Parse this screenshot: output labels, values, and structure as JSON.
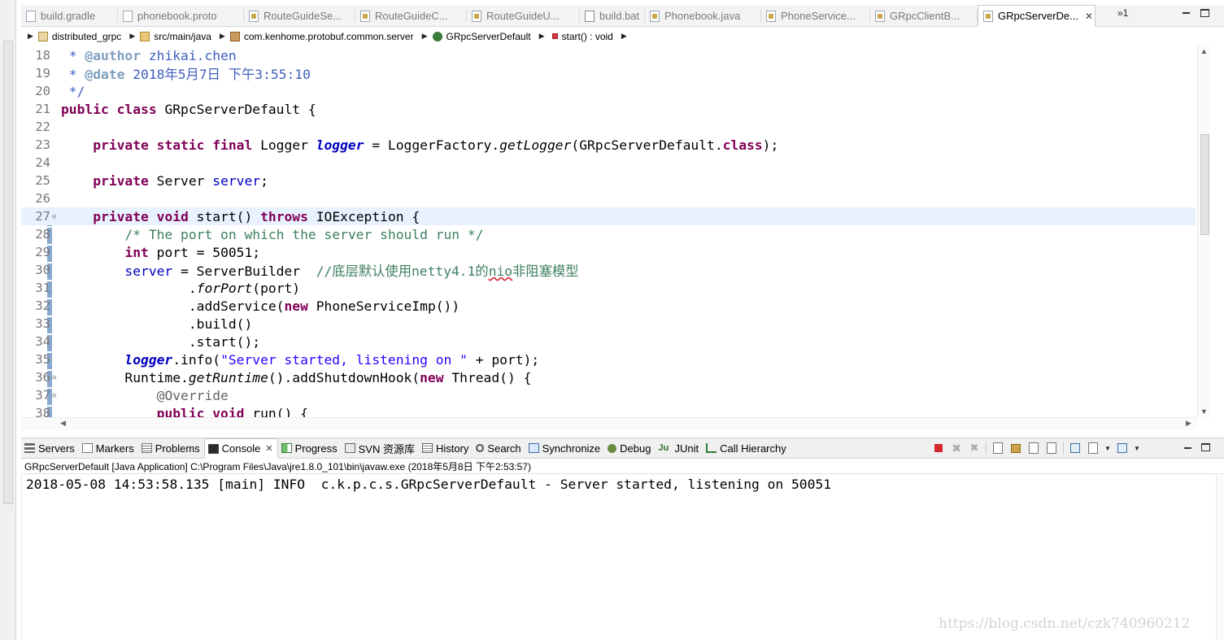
{
  "editor_tabs": [
    {
      "label": "build.gradle",
      "icon": "gradle-file-icon",
      "active": false
    },
    {
      "label": "phonebook.proto",
      "icon": "proto-file-icon",
      "active": false
    },
    {
      "label": "RouteGuideSe...",
      "icon": "java-file-icon",
      "active": false
    },
    {
      "label": "RouteGuideC...",
      "icon": "java-file-icon",
      "active": false
    },
    {
      "label": "RouteGuideU...",
      "icon": "java-file-icon",
      "active": false
    },
    {
      "label": "build.bat",
      "icon": "bat-file-icon",
      "active": false
    },
    {
      "label": "Phonebook.java",
      "icon": "java-file-icon",
      "active": false
    },
    {
      "label": "PhoneService...",
      "icon": "java-file-icon",
      "active": false
    },
    {
      "label": "GRpcClientB...",
      "icon": "java-file-icon",
      "active": false
    },
    {
      "label": "GRpcServerDe...",
      "icon": "java-file-icon",
      "active": true
    }
  ],
  "tabs_overflow": "»1",
  "breadcrumb": {
    "project": "distributed_grpc",
    "source_folder": "src/main/java",
    "package": "com.kenhome.protobuf.common.server",
    "class": "GRpcServerDefault",
    "method": "start() : void"
  },
  "code_lines": [
    {
      "n": "18",
      "fold": ""
    },
    {
      "n": "19",
      "fold": ""
    },
    {
      "n": "20",
      "fold": ""
    },
    {
      "n": "21",
      "fold": ""
    },
    {
      "n": "22",
      "fold": ""
    },
    {
      "n": "23",
      "fold": ""
    },
    {
      "n": "24",
      "fold": ""
    },
    {
      "n": "25",
      "fold": ""
    },
    {
      "n": "26",
      "fold": ""
    },
    {
      "n": "27",
      "fold": "⊖"
    },
    {
      "n": "28",
      "fold": ""
    },
    {
      "n": "29",
      "fold": ""
    },
    {
      "n": "30",
      "fold": ""
    },
    {
      "n": "31",
      "fold": ""
    },
    {
      "n": "32",
      "fold": ""
    },
    {
      "n": "33",
      "fold": ""
    },
    {
      "n": "34",
      "fold": ""
    },
    {
      "n": "35",
      "fold": ""
    },
    {
      "n": "36",
      "fold": "⊖"
    },
    {
      "n": "37",
      "fold": "⊖"
    },
    {
      "n": "38",
      "fold": ""
    }
  ],
  "code": {
    "l18": {
      "star": " * ",
      "tag": "@author",
      "text": " zhikai.chen"
    },
    "l19": {
      "star": " * ",
      "tag": "@date",
      "text": " 2018年5月7日 下午3:55:10"
    },
    "l20": {
      "text": " */"
    },
    "l21": {
      "kw": "public class",
      "text": " GRpcServerDefault {"
    },
    "l23": {
      "indent": "    ",
      "kw": "private static final",
      "t1": " Logger ",
      "field": "logger",
      "t2": " = LoggerFactory.",
      "method": "getLogger",
      "t3": "(GRpcServerDefault.",
      "kw2": "class",
      "t4": ");"
    },
    "l25": {
      "indent": "    ",
      "kw": "private",
      "t1": " Server ",
      "field": "server",
      "t2": ";"
    },
    "l27": {
      "indent": "    ",
      "kw": "private void",
      "t1": " start() ",
      "kw2": "throws",
      "t2": " IOException {"
    },
    "l28": {
      "indent": "        ",
      "comment": "/* The port on which the server should run */"
    },
    "l29": {
      "indent": "        ",
      "kw": "int",
      "t1": " port = 50051;"
    },
    "l30": {
      "indent": "        ",
      "field": "server",
      "t1": " = ServerBuilder  ",
      "comment_a": "//底层默认使用netty4.1的",
      "comment_b": "nio",
      "comment_c": "非阻塞模型"
    },
    "l31": {
      "indent": "                ",
      "t1": ".",
      "method": "forPort",
      "t2": "(port)"
    },
    "l32": {
      "indent": "                ",
      "t1": ".addService(",
      "kw": "new",
      "t2": " PhoneServiceImp())"
    },
    "l33": {
      "indent": "                ",
      "t1": ".build()"
    },
    "l34": {
      "indent": "                ",
      "t1": ".start();"
    },
    "l35": {
      "indent": "        ",
      "field": "logger",
      "t1": ".info(",
      "str": "\"Server started, listening on \"",
      "t2": " + port);"
    },
    "l36": {
      "indent": "        ",
      "t1": "Runtime.",
      "method": "getRuntime",
      "t2": "().addShutdownHook(",
      "kw": "new",
      "t3": " Thread() {"
    },
    "l37": {
      "indent": "            ",
      "ann": "@Override"
    },
    "l38": {
      "indent": "            ",
      "kw": "public void",
      "t1": " run() {"
    }
  },
  "views": [
    {
      "label": "Servers",
      "icon": "servers-icon",
      "active": false
    },
    {
      "label": "Markers",
      "icon": "markers-icon",
      "active": false
    },
    {
      "label": "Problems",
      "icon": "problems-icon",
      "active": false
    },
    {
      "label": "Console",
      "icon": "console-icon",
      "active": true
    },
    {
      "label": "Progress",
      "icon": "progress-icon",
      "active": false
    },
    {
      "label": "SVN 资源库",
      "icon": "svn-repository-icon",
      "active": false
    },
    {
      "label": "History",
      "icon": "history-icon",
      "active": false
    },
    {
      "label": "Search",
      "icon": "search-icon",
      "active": false
    },
    {
      "label": "Synchronize",
      "icon": "synchronize-icon",
      "active": false
    },
    {
      "label": "Debug",
      "icon": "debug-icon",
      "active": false
    },
    {
      "label": "JUnit",
      "icon": "junit-icon",
      "active": false
    },
    {
      "label": "Call Hierarchy",
      "icon": "call-hierarchy-icon",
      "active": false
    }
  ],
  "junit_glyph": "Ju",
  "console": {
    "description": "GRpcServerDefault [Java Application] C:\\Program Files\\Java\\jre1.8.0_101\\bin\\javaw.exe (2018年5月8日 下午2:53:57)",
    "output": "2018-05-08 14:53:58.135 [main] INFO  c.k.p.c.s.GRpcServerDefault - Server started, listening on 50051"
  },
  "watermark": "https://blog.csdn.net/czk740960212",
  "colors": {
    "keyword": "#7f0055",
    "comment": "#3f7f5f",
    "javadoc": "#3f5fbf",
    "field": "#0000c0",
    "string": "#2a00ff",
    "current_line": "#e8f2fe",
    "stop_button": "#d6262d"
  }
}
